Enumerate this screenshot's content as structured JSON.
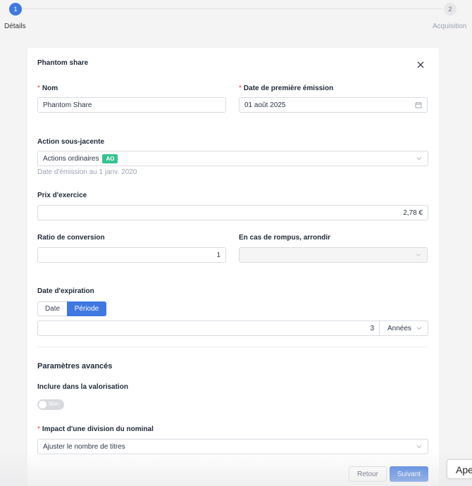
{
  "stepper": {
    "steps": [
      {
        "number": "1",
        "label": "Détails",
        "active": true
      },
      {
        "number": "2",
        "label": "Acquisition",
        "active": false
      }
    ]
  },
  "form": {
    "title": "Phantom share",
    "nom": {
      "label": "Nom",
      "value": "Phantom Share",
      "required": true
    },
    "date_emission": {
      "label": "Date de première émission",
      "value": "01 août 2025",
      "required": true,
      "icon": "calendar-icon"
    },
    "action_sous_jacente": {
      "label": "Action sous-jacente",
      "value": "Actions ordinaires",
      "badge": "AO",
      "hint": "Date d'émission au 1 janv. 2020"
    },
    "prix_exercice": {
      "label": "Prix d'exercice",
      "value": "2,78 €"
    },
    "ratio_conversion": {
      "label": "Ratio de conversion",
      "value": "1"
    },
    "arrondi": {
      "label": "En cas de rompus, arrondir",
      "value": ""
    },
    "date_expiration": {
      "label": "Date d'expiration",
      "options": [
        "Date",
        "Période"
      ],
      "selected": "Période",
      "duration_value": "3",
      "unit": "Années"
    },
    "advanced": {
      "title": "Paramètres avancés"
    },
    "valorisation": {
      "label": "Inclure dans la valorisation",
      "toggle_text": "Non",
      "enabled": false
    },
    "impact_division": {
      "label": "Impact d'une division du nominal",
      "value": "Ajuster le nombre de titres",
      "required": true
    }
  },
  "buttons": {
    "back": "Retour",
    "next": "Suivant"
  },
  "peek_popup": {
    "text": "Ape"
  },
  "colors": {
    "primary": "#3f78e0",
    "badge": "#34c38f",
    "required": "#e53e3e"
  }
}
